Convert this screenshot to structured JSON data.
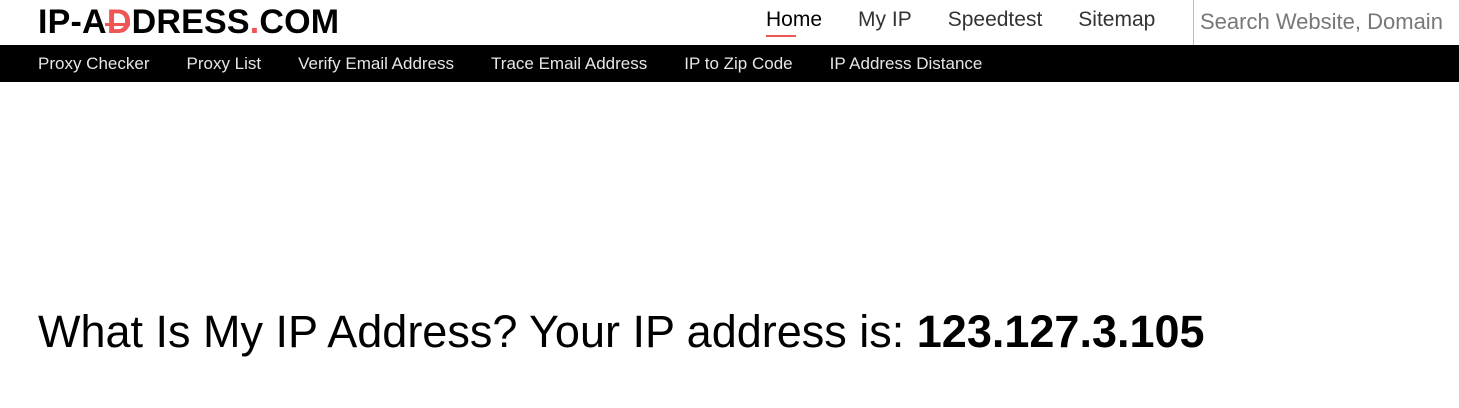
{
  "header": {
    "logo": {
      "part1": "IP-A",
      "part_d": "D",
      "part2": "DRESS",
      "part_dot": ".",
      "part3": "COM"
    },
    "nav": [
      {
        "label": "Home",
        "active": true
      },
      {
        "label": "My IP",
        "active": false
      },
      {
        "label": "Speedtest",
        "active": false
      },
      {
        "label": "Sitemap",
        "active": false
      }
    ],
    "search": {
      "placeholder": "Search Website, Domain",
      "value": ""
    }
  },
  "subnav": {
    "items": [
      "Proxy Checker",
      "Proxy List",
      "Verify Email Address",
      "Trace Email Address",
      "IP to Zip Code",
      "IP Address Distance"
    ]
  },
  "main": {
    "headline_text": "What Is My IP Address? Your IP address is: ",
    "ip_address": "123.127.3.105"
  },
  "colors": {
    "accent": "#ee5555",
    "subnav_background": "#000000",
    "subnav_text": "#e6e6e6"
  }
}
